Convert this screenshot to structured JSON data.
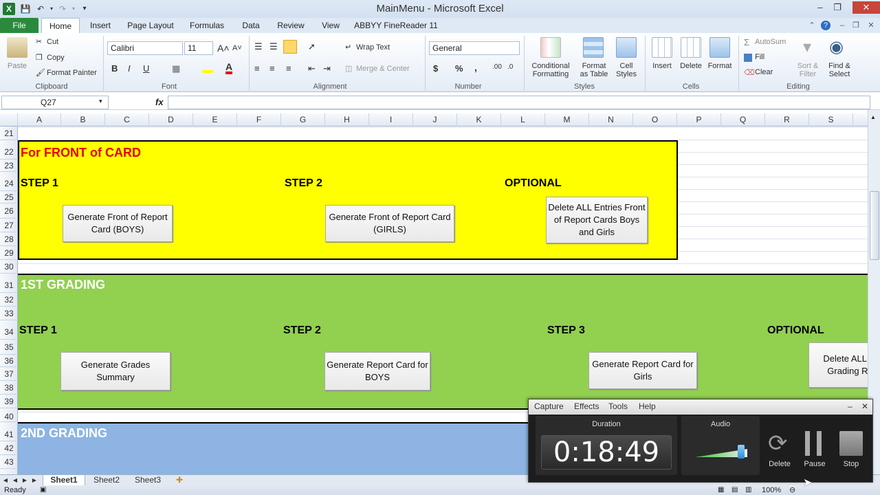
{
  "window": {
    "title": "MainMenu  -  Microsoft Excel"
  },
  "tabs": [
    "File",
    "Home",
    "Insert",
    "Page Layout",
    "Formulas",
    "Data",
    "Review",
    "View",
    "ABBYY FineReader 11"
  ],
  "ribbon": {
    "clipboard": {
      "paste": "Paste",
      "cut": "Cut",
      "copy": "Copy",
      "format_painter": "Format Painter",
      "label": "Clipboard"
    },
    "font": {
      "name": "Calibri",
      "size": "11",
      "bold": "B",
      "italic": "I",
      "underline": "U",
      "label": "Font"
    },
    "alignment": {
      "wrap_text": "Wrap Text",
      "merge_center": "Merge & Center",
      "label": "Alignment"
    },
    "number": {
      "format": "General",
      "currency": "$",
      "percent": "%",
      "comma": ",",
      "label": "Number"
    },
    "styles": {
      "conditional": "Conditional",
      "conditional_2": "Formatting",
      "format_table": "Format",
      "format_table_2": "as Table",
      "cell_styles": "Cell",
      "cell_styles_2": "Styles",
      "label": "Styles"
    },
    "cells": {
      "insert": "Insert",
      "delete": "Delete",
      "format": "Format",
      "label": "Cells"
    },
    "editing": {
      "autosum": "AutoSum",
      "fill": "Fill",
      "clear": "Clear",
      "sort": "Sort &",
      "sort_2": "Filter",
      "find": "Find &",
      "find_2": "Select",
      "label": "Editing"
    }
  },
  "formula_bar": {
    "name_box": "Q27",
    "fx": "fx",
    "value": ""
  },
  "columns": [
    "A",
    "B",
    "C",
    "D",
    "E",
    "F",
    "G",
    "H",
    "I",
    "J",
    "K",
    "L",
    "M",
    "N",
    "O",
    "P",
    "Q",
    "R",
    "S"
  ],
  "rows": [
    "21",
    "22",
    "23",
    "24",
    "25",
    "26",
    "27",
    "28",
    "29",
    "30",
    "31",
    "32",
    "33",
    "34",
    "35",
    "36",
    "37",
    "38",
    "39",
    "40",
    "41",
    "42",
    "43"
  ],
  "sheet": {
    "front": {
      "title": "For FRONT of CARD",
      "step1": "STEP 1",
      "step2": "STEP 2",
      "optional": "OPTIONAL",
      "btn_boys": "Generate Front of Report Card (BOYS)",
      "btn_girls": "Generate Front of Report Card (GIRLS)",
      "btn_delete": "Delete ALL Entries Front of Report Cards Boys and Girls"
    },
    "first": {
      "title": "1ST GRADING",
      "step1": "STEP 1",
      "step2": "STEP 2",
      "step3": "STEP 3",
      "optional": "OPTIONAL",
      "btn_summary": "Generate Grades Summary",
      "btn_boys": "Generate Report Card for BOYS",
      "btn_girls": "Generate Report Card for Girls",
      "btn_delete": "Delete ALL Entries Grading Reports"
    },
    "second": {
      "title": "2ND GRADING"
    }
  },
  "sheet_tabs": [
    "Sheet1",
    "Sheet2",
    "Sheet3"
  ],
  "status": {
    "ready": "Ready",
    "zoom": "100%"
  },
  "recorder": {
    "menu": [
      "Capture",
      "Effects",
      "Tools",
      "Help"
    ],
    "duration_label": "Duration",
    "duration": "0:18:49",
    "audio_label": "Audio",
    "delete": "Delete",
    "pause": "Pause",
    "stop": "Stop"
  }
}
